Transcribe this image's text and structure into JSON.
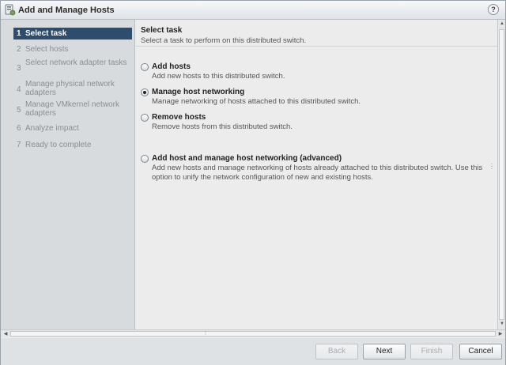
{
  "window": {
    "title": "Add and Manage Hosts",
    "help": "?"
  },
  "steps": [
    {
      "num": "1",
      "label": "Select task",
      "active": true
    },
    {
      "num": "2",
      "label": "Select hosts",
      "active": false
    },
    {
      "num": "3",
      "label": "Select network adapter tasks",
      "active": false
    },
    {
      "num": "4",
      "label": "Manage physical network adapters",
      "active": false
    },
    {
      "num": "5",
      "label": "Manage VMkernel network adapters",
      "active": false
    },
    {
      "num": "6",
      "label": "Analyze impact",
      "active": false
    },
    {
      "num": "7",
      "label": "Ready to complete",
      "active": false
    }
  ],
  "content": {
    "title": "Select task",
    "subtitle": "Select a task to perform on this distributed switch.",
    "options": [
      {
        "label": "Add hosts",
        "desc": "Add new hosts to this distributed switch.",
        "checked": false
      },
      {
        "label": "Manage host networking",
        "desc": "Manage networking of hosts attached to this distributed switch.",
        "checked": true
      },
      {
        "label": "Remove hosts",
        "desc": "Remove hosts from this distributed switch.",
        "checked": false
      },
      {
        "label": "Add host and manage host networking (advanced)",
        "desc": "Add new hosts and manage networking of hosts already attached to this distributed switch. Use this option to unify the network configuration of new and existing hosts.",
        "checked": false
      }
    ]
  },
  "footer": {
    "back": "Back",
    "next": "Next",
    "finish": "Finish",
    "cancel": "Cancel"
  },
  "colors": {
    "active_step_bg": "#2e4d6e",
    "panel_bg": "#d8dbde"
  },
  "icons": {
    "title": "hosts-wizard-icon",
    "help": "help-icon"
  }
}
